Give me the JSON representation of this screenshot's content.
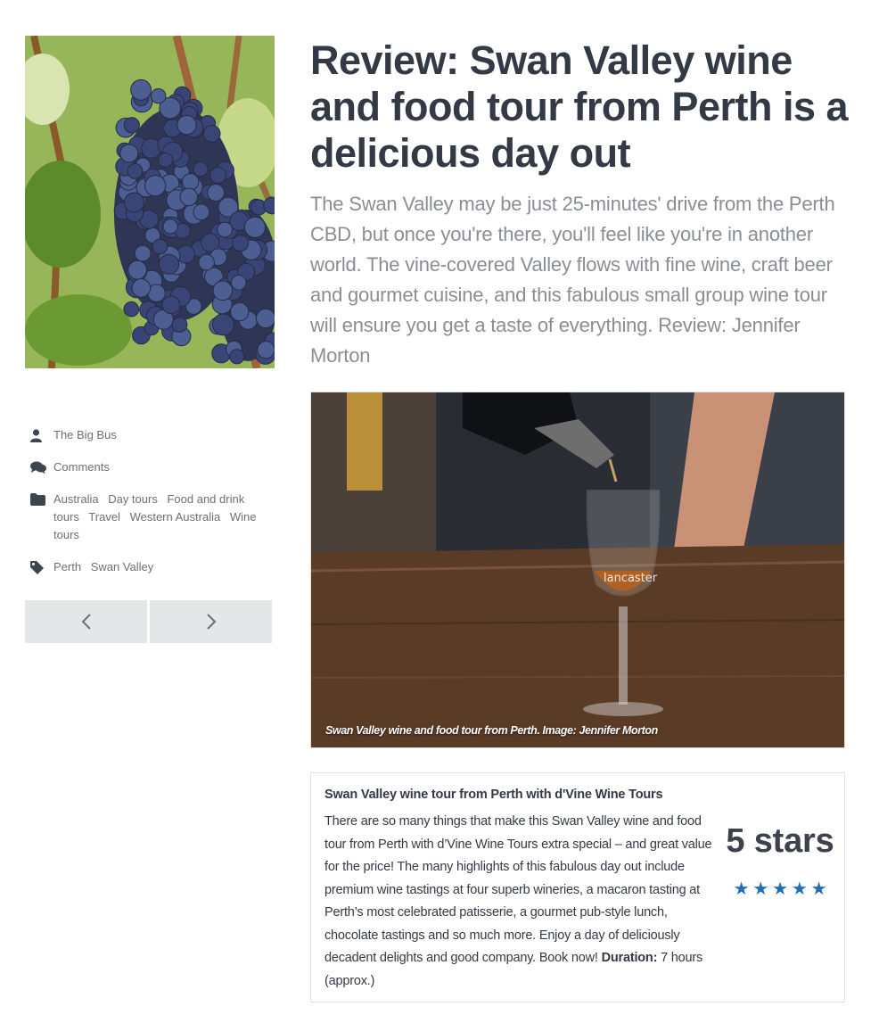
{
  "article": {
    "title": "Review: Swan Valley wine and food tour from Perth is a delicious day out",
    "lead": "The Swan Valley may be just 25-minutes' drive from the Perth CBD, but once you're there, you'll feel like you're in another world. The vine-covered Valley flows with fine wine, craft beer and gourmet cuisine, and this fabulous small group wine tour will ensure you get a taste of everything. Review: Jennifer Morton"
  },
  "sidebar": {
    "author": "The Big Bus",
    "comments": "Comments",
    "categories": [
      "Australia",
      "Day tours",
      "Food and drink tours",
      "Travel",
      "Western Australia",
      "Wine tours"
    ],
    "tags": [
      "Perth",
      "Swan Valley"
    ],
    "icons": {
      "author": "user-icon",
      "comments": "comments-icon",
      "categories": "folder-icon",
      "tags": "tag-icon",
      "prev": "chevron-left-icon",
      "next": "chevron-right-icon"
    }
  },
  "hero": {
    "caption": "Swan Valley wine and food tour from Perth. Image: Jennifer Morton",
    "glass_text": "lancaster"
  },
  "review": {
    "title": "Swan Valley wine tour from Perth with d'Vine Wine Tours",
    "body": "There are so many things that make this Swan Valley wine and food tour from Perth with d’Vine Wine Tours extra special – and great value for the price! The many highlights of this fabulous day out include premium wine tastings at four superb wineries, a macaron tasting at Perth’s most celebrated patisserie, a gourmet pub-style lunch, chocolate tastings and so much more. Enjoy a day of deliciously decadent delights and good company. Book now!",
    "duration_label": "Duration:",
    "duration_value": "7 hours (approx.)",
    "rating_text": "5 stars",
    "rating_value": 5,
    "rating_max": 5
  },
  "colors": {
    "title": "#333a45",
    "lead": "#8a8e94",
    "meta": "#6b7079",
    "star": "#1f6fb8",
    "nav_bg": "#e5e6e8"
  }
}
